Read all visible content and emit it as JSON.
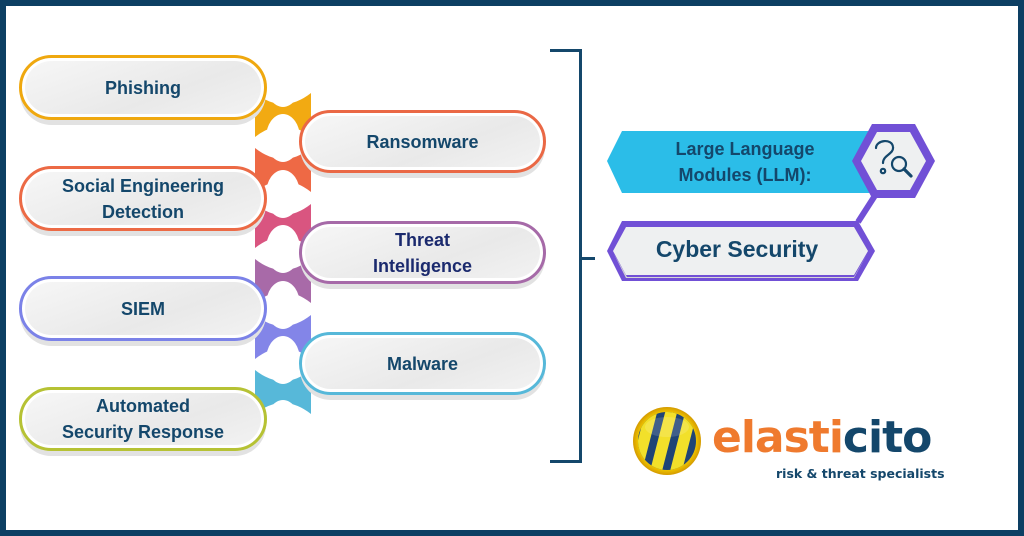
{
  "topics": {
    "left": [
      {
        "lines": [
          "Phishing"
        ],
        "color": "#efa80f"
      },
      {
        "lines": [
          "Social Engineering",
          "Detection"
        ],
        "color": "#ec6a45"
      },
      {
        "lines": [
          "SIEM"
        ],
        "color": "#7b82e8"
      },
      {
        "lines": [
          "Automated",
          "Security Response"
        ],
        "color": "#b6c234"
      }
    ],
    "right": [
      {
        "lines": [
          "Ransomware"
        ],
        "color": "#ea6845"
      },
      {
        "lines": [
          "Threat",
          "Intelligence"
        ],
        "color": "#a66aa8"
      },
      {
        "lines": [
          "Malware"
        ],
        "color": "#56b8d9"
      }
    ],
    "connector_colors": [
      "#f2aa12",
      "#ee6945",
      "#d95580",
      "#a86aa8",
      "#8385e8",
      "#57b8d9"
    ]
  },
  "title_block": {
    "banner_lines": [
      "Large Language",
      "Modules (LLM):"
    ],
    "banner_color": "#2bbde8",
    "accent_color": "#7150d6",
    "subject": "Cyber Security",
    "icon": "question-search-icon"
  },
  "logo": {
    "name_part1": "elasti",
    "name_part2": "cito",
    "tagline": "risk & threat specialists",
    "color_orange": "#ef7a2e",
    "color_navy": "#14476b"
  },
  "colors": {
    "frame": "#0d3f63",
    "text": "#14476b"
  }
}
